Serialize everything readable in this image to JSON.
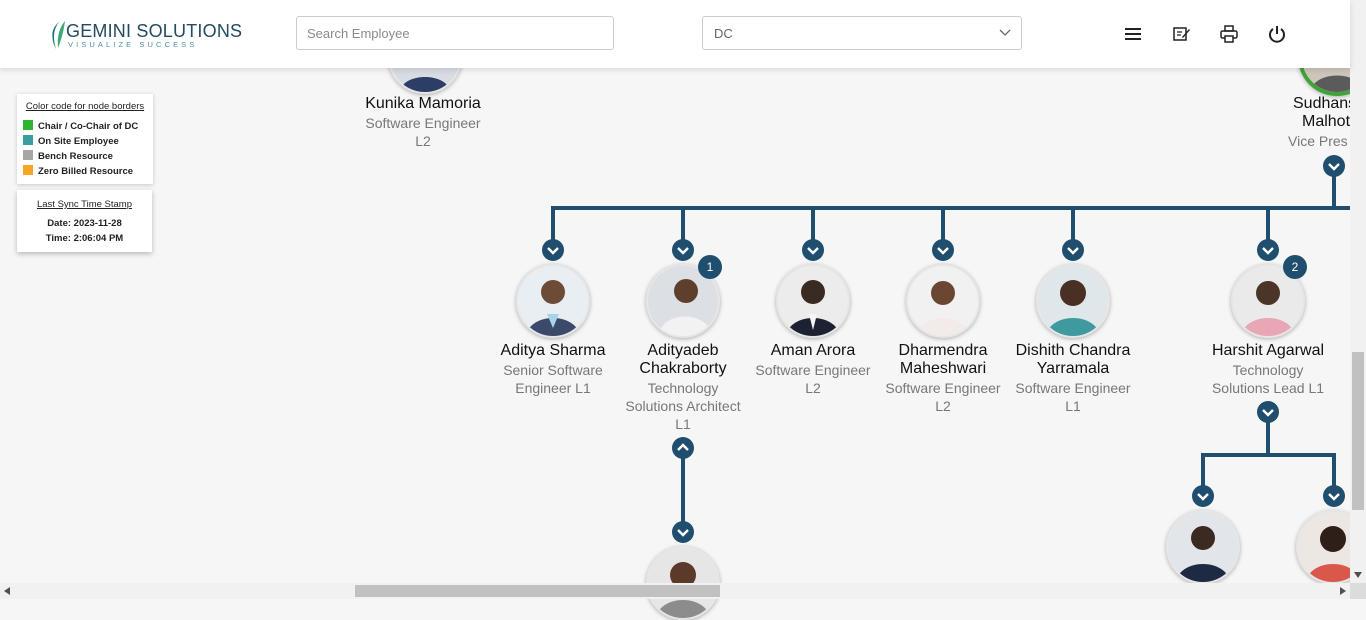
{
  "header": {
    "logo": {
      "name": "GEMINI SOLUTIONS",
      "tagline": "VISUALIZE SUCCESS"
    },
    "search": {
      "placeholder": "Search Employee",
      "value": ""
    },
    "dc_select": {
      "value": "DC"
    },
    "icons": [
      "hamburger-icon",
      "edit-document-icon",
      "printer-icon",
      "power-icon"
    ]
  },
  "legend": {
    "title": "Color code for node borders",
    "items": [
      {
        "label": "Chair / Co-Chair of DC",
        "color": "#2db52d"
      },
      {
        "label": "On Site Employee",
        "color": "#3a9ea0"
      },
      {
        "label": "Bench Resource",
        "color": "#a6a6a6"
      },
      {
        "label": "Zero Billed Resource",
        "color": "#f5a623"
      }
    ]
  },
  "sync": {
    "title": "Last Sync Time Stamp",
    "date": "Date: 2023-11-28",
    "time": "Time: 2:06:04 PM"
  },
  "nodes": {
    "kunika": {
      "name": "Kunika Mamoria",
      "title": [
        "Software Engineer",
        "L2"
      ]
    },
    "sudhanshu": {
      "name": [
        "Sudhans",
        "Malhot"
      ],
      "title": [
        "Vice Pres"
      ]
    },
    "aditya": {
      "name": [
        "Aditya Sharma"
      ],
      "title": [
        "Senior Software",
        "Engineer L1"
      ]
    },
    "adityadeb": {
      "name": [
        "Adityadeb",
        "Chakraborty"
      ],
      "title": [
        "Technology",
        "Solutions Architect",
        "L1"
      ],
      "badge": "1"
    },
    "aman": {
      "name": [
        "Aman Arora"
      ],
      "title": [
        "Software Engineer",
        "L2"
      ]
    },
    "dharmendra": {
      "name": [
        "Dharmendra",
        "Maheshwari"
      ],
      "title": [
        "Software Engineer",
        "L2"
      ]
    },
    "dishith": {
      "name": [
        "Dishith Chandra",
        "Yarramala"
      ],
      "title": [
        "Software Engineer",
        "L1"
      ]
    },
    "harshit": {
      "name": [
        "Harshit Agarwal"
      ],
      "title": [
        "Technology",
        "Solutions Lead L1"
      ],
      "badge": "2"
    }
  },
  "colors": {
    "connector": "#1f4e6e",
    "accent_green": "#3fa33a"
  }
}
